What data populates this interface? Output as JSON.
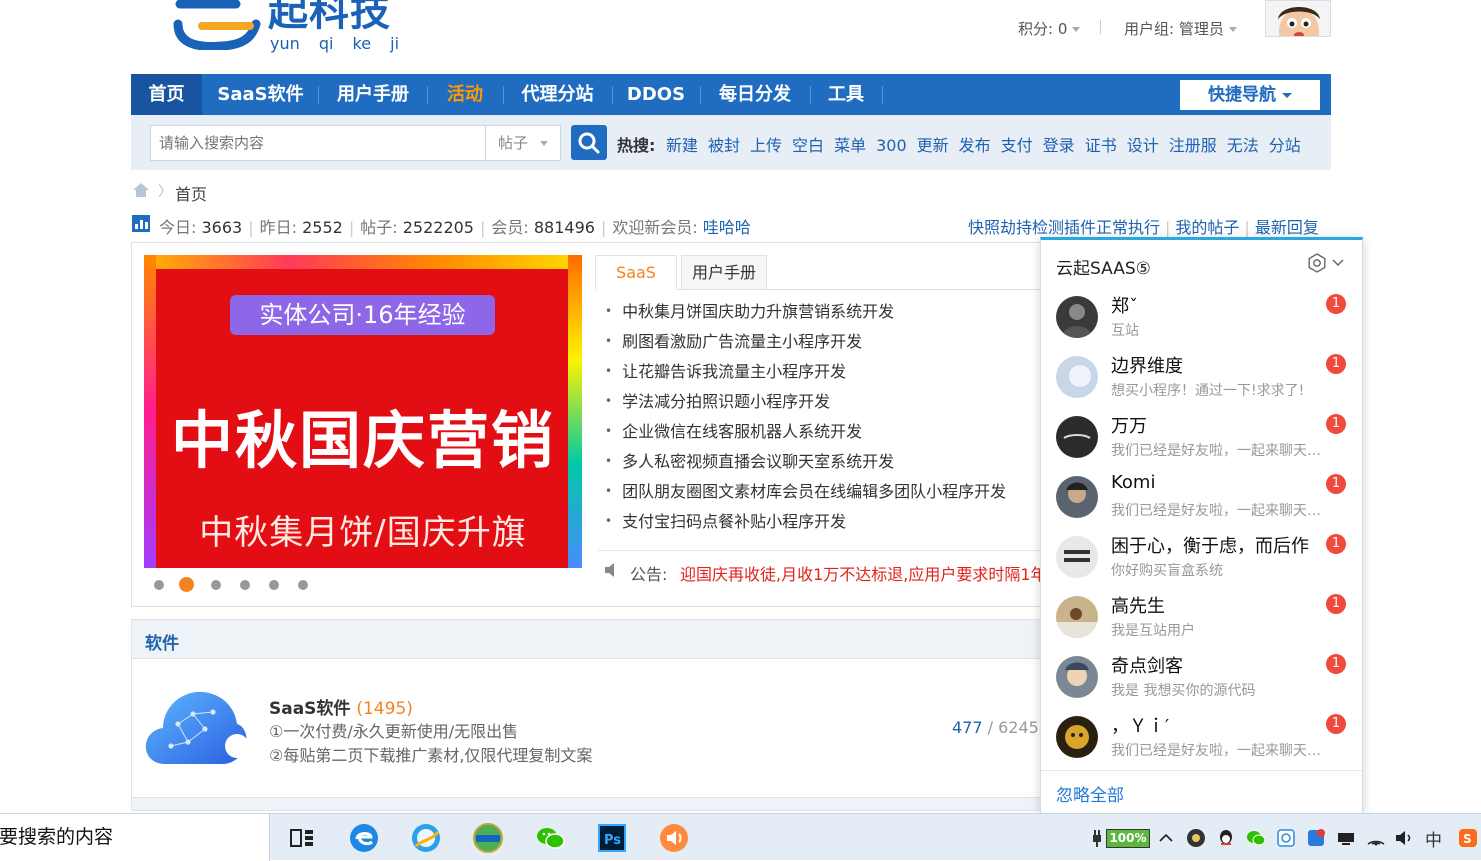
{
  "header": {
    "logo_cn": "起科技",
    "logo_pinyin": "yun qi ke ji",
    "points_label": "积分: 0",
    "usergroup_label": "用户组: 管理员"
  },
  "nav": {
    "items": [
      "首页",
      "SaaS软件",
      "用户手册",
      "活动",
      "代理分站",
      "DDOS",
      "每日分发",
      "工具"
    ],
    "quick_nav": "快捷导航"
  },
  "search": {
    "placeholder": "请输入搜索内容",
    "type": "帖子",
    "hot_label": "热搜:",
    "hot_terms": [
      "新建",
      "被封",
      "上传",
      "空白",
      "菜单",
      "300",
      "更新",
      "发布",
      "支付",
      "登录",
      "证书",
      "设计",
      "注册服",
      "无法",
      "分站"
    ]
  },
  "breadcrumb": {
    "home": "首页",
    "arrow": "〉"
  },
  "stats": {
    "today_label": "今日:",
    "today": "3663",
    "yesterday_label": "昨日:",
    "yesterday": "2552",
    "posts_label": "帖子:",
    "posts": "2522205",
    "members_label": "会员:",
    "members": "881496",
    "newest_label": "欢迎新会员:",
    "newest": "哇哈哈"
  },
  "toplinks": [
    "快照劫持检测插件正常执行",
    "我的帖子",
    "最新回复"
  ],
  "banner": {
    "pill": "实体公司·16年经验",
    "main": "中秋国庆营销",
    "sub": "中秋集月饼/国庆升旗",
    "active_dot": 1
  },
  "tabs": [
    "SaaS",
    "用户手册"
  ],
  "articles": [
    "中秋集月饼国庆助力升旗营销系统开发",
    "刷图看激励广告流量主小程序开发",
    "让花瓣告诉我流量主小程序开发",
    "学法减分拍照识题小程序开发",
    "企业微信在线客服机器人系统开发",
    "多人私密视频直播会议聊天室系统开发",
    "团队朋友圈图文素材库会员在线编辑多团队小程序开发",
    "支付宝扫码点餐补贴小程序开发"
  ],
  "notice": {
    "label": "公告:",
    "text": "迎国庆再收徒,月收1万不达标退,应用户要求时隔1年"
  },
  "software": {
    "section_title": "软件",
    "name": "SaaS软件",
    "count": "(1495)",
    "line1": "①一次付费/永久更新使用/无限出售",
    "line2": "②每贴第二页下载推广素材,仅限代理复制文案",
    "threads": "477",
    "slash": " / ",
    "posts": "6245"
  },
  "chat": {
    "title": "云起SAAS⑤",
    "ignore_all": "忽略全部",
    "items": [
      {
        "name": "郑ˇ",
        "msg": "互站",
        "badge": "1",
        "avatar_color": "#3a3a3a"
      },
      {
        "name": "边界维度",
        "msg": "想买小程序！通过一下!求求了!",
        "badge": "1",
        "avatar_color": "#c9d6e8"
      },
      {
        "name": "万万",
        "msg": "我们已经是好友啦，一起来聊天吧！",
        "badge": "1",
        "avatar_color": "#2b2b2b"
      },
      {
        "name": "Komi",
        "msg": "我们已经是好友啦，一起来聊天吧！",
        "badge": "1",
        "avatar_color": "#5a6470"
      },
      {
        "name": "困于心，衡于虑，而后作",
        "msg": "你好购买盲盒系统",
        "badge": "1",
        "avatar_color": "#e8e8e8"
      },
      {
        "name": "高先生",
        "msg": "我是互站用户",
        "badge": "1",
        "avatar_color": "#c9b38a"
      },
      {
        "name": "奇点剑客",
        "msg": "我是  我想买你的源代码",
        "badge": "1",
        "avatar_color": "#7a8896"
      },
      {
        "name": "，Ｙｉ′",
        "msg": "我们已经是好友啦，一起来聊天吧！",
        "badge": "1",
        "avatar_color": "#2a2010"
      }
    ]
  },
  "taskbar": {
    "search_text": "你要搜索的内容",
    "battery": "100%",
    "ime": "中"
  }
}
